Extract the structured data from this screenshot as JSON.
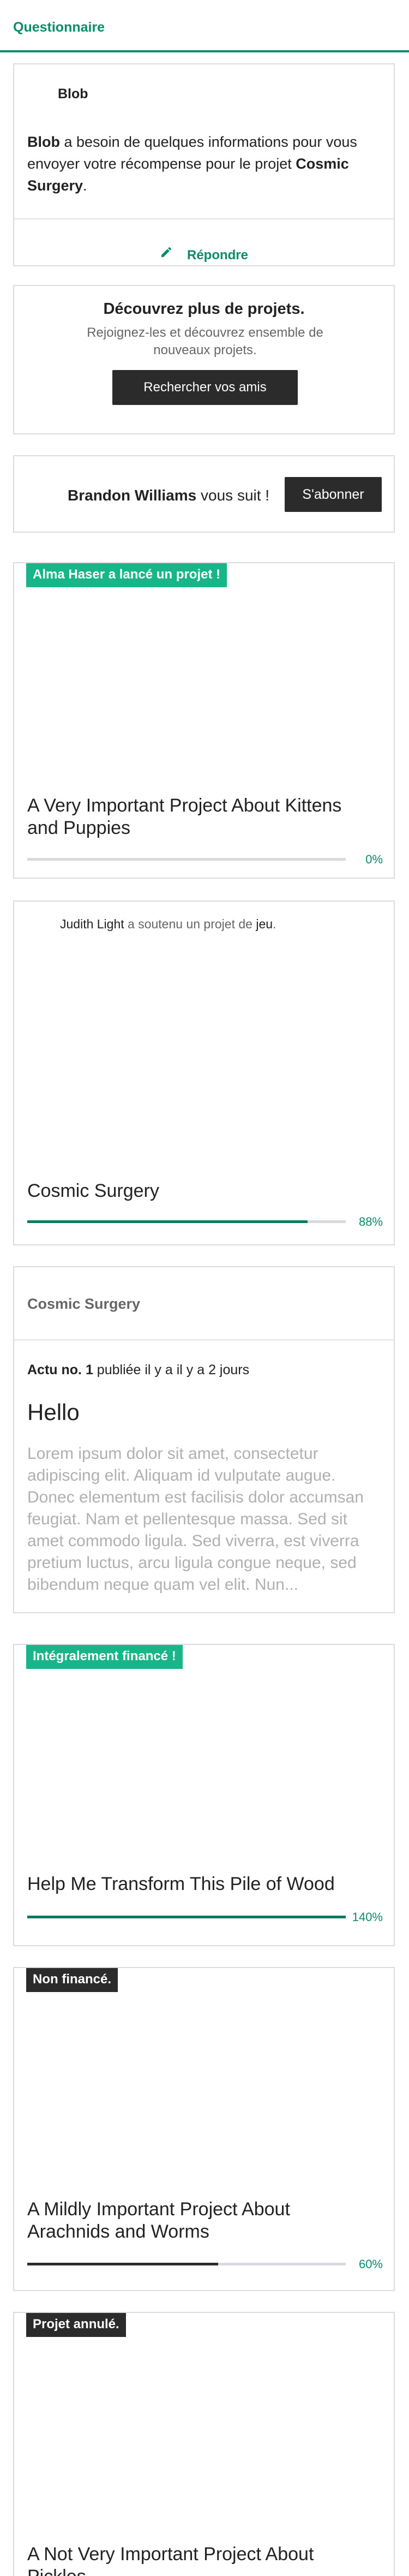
{
  "header": {
    "title": "Questionnaire"
  },
  "questionnaire": {
    "user": "Blob",
    "message_user": "Blob",
    "message_mid": " a besoin de quelques informations pour vous envoyer votre récompense pour le projet ",
    "message_project": "Cosmic Surgery",
    "message_end": ".",
    "reply_label": "Répondre",
    "reply_icon": "pencil-icon"
  },
  "discover": {
    "title": "Découvrez plus de projets.",
    "subtitle": "Rejoignez-les et découvrez ensemble de nouveaux projets.",
    "button": "Rechercher vos amis"
  },
  "follow": {
    "name": "Brandon Williams",
    "text": " vous suit !",
    "button": "S'abonner"
  },
  "projects": [
    {
      "badge": "Alma Haser a lancé un projet !",
      "title": "A Very Important Project About Kittens and Puppies",
      "percent_label": "0%",
      "progress": 0.0
    },
    {
      "activity_user": "Judith Light",
      "activity_mid": " a soutenu un projet de ",
      "activity_cat": "jeu",
      "activity_end": ".",
      "title": "Cosmic Surgery",
      "percent_label": "88%",
      "progress": 0.88
    },
    {
      "badge": "Intégralement financé !",
      "title": "Help Me Transform This Pile of Wood",
      "percent_label": "140%",
      "progress": 1.0
    },
    {
      "badge": "Non financé.",
      "title": "A Mildly Important Project About Arachnids and Worms",
      "percent_label": "60%",
      "progress": 0.6
    },
    {
      "badge": "Projet annulé.",
      "title": "A Not Very Important Project About Pickles"
    }
  ],
  "update": {
    "project": "Cosmic Surgery",
    "label": "Actu no.",
    "number": "1",
    "meta": " publiée il y a il y a 2 jours",
    "title": "Hello",
    "body": "Lorem ipsum dolor sit amet, consectetur adipiscing elit. Aliquam id vulputate augue. Donec elementum est facilisis dolor accumsan feugiat. Nam et pellentesque massa. Sed sit amet commodo ligula. Sed viverra, est viverra pretium luctus, arcu ligula congue neque, sed bibendum neque quam vel elit. Nun..."
  },
  "colors": {
    "accent": "#0b8c6b",
    "badge_green": "#18b589",
    "dark": "#2b2b2b"
  }
}
